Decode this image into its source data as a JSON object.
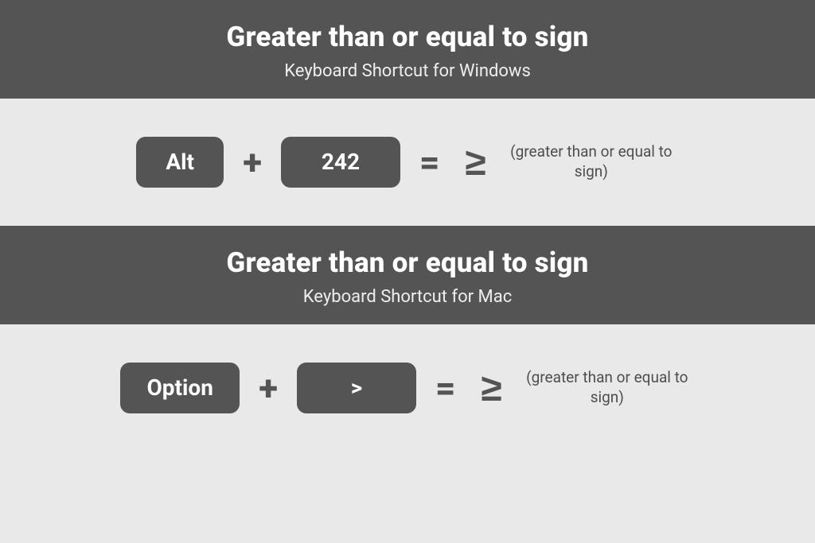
{
  "sections": [
    {
      "title": "Greater than or equal to sign",
      "subtitle": "Keyboard Shortcut for Windows",
      "key1": "Alt",
      "plus": "+",
      "key2": "242",
      "equals": "=",
      "result_symbol": "≥",
      "result_label": "(greater than or equal to sign)"
    },
    {
      "title": "Greater than or equal to sign",
      "subtitle": "Keyboard Shortcut for Mac",
      "key1": "Option",
      "plus": "+",
      "key2": ">",
      "equals": "=",
      "result_symbol": "≥",
      "result_label": "(greater than or equal to sign)"
    }
  ]
}
